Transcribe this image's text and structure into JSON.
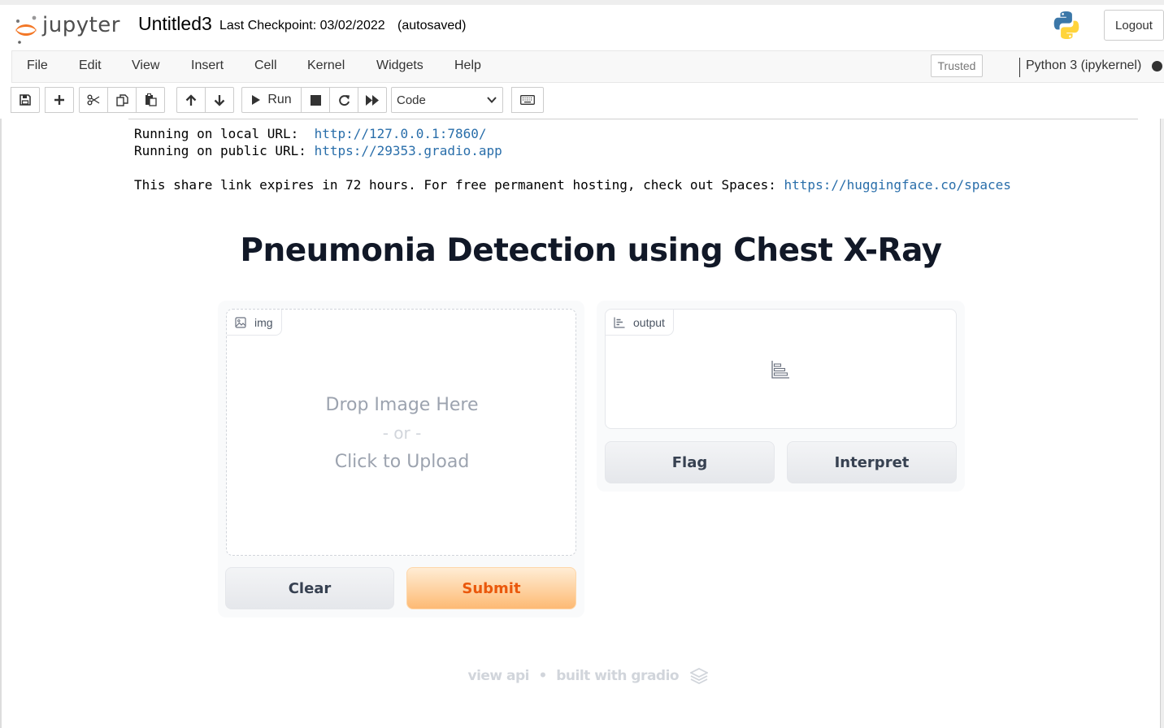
{
  "header": {
    "logo_text": "jupyter",
    "notebook_name": "Untitled3",
    "checkpoint": "Last Checkpoint: 03/02/2022",
    "autosave": "(autosaved)",
    "logout_label": "Logout"
  },
  "menubar": {
    "items": [
      "File",
      "Edit",
      "View",
      "Insert",
      "Cell",
      "Kernel",
      "Widgets",
      "Help"
    ],
    "trusted_label": "Trusted",
    "kernel_name": "Python 3 (ipykernel)"
  },
  "toolbar": {
    "run_label": "Run",
    "cell_type": "Code",
    "cell_type_options": [
      "Code"
    ]
  },
  "output": {
    "local_prefix": "Running on local URL:  ",
    "local_url": "http://127.0.0.1:7860/",
    "public_prefix": "Running on public URL: ",
    "public_url": "https://29353.gradio.app",
    "share_text": "This share link expires in 72 hours. For free permanent hosting, check out Spaces: ",
    "spaces_url": "https://huggingface.co/spaces"
  },
  "gradio": {
    "title": "Pneumonia Detection using Chest X-Ray",
    "input_label": "img",
    "drop_line1": "Drop Image Here",
    "drop_line2": "- or -",
    "drop_line3": "Click to Upload",
    "clear_label": "Clear",
    "submit_label": "Submit",
    "output_label": "output",
    "flag_label": "Flag",
    "interpret_label": "Interpret",
    "footer_api": "view api",
    "footer_dot": "•",
    "footer_built": "built with gradio"
  },
  "colors": {
    "jupyter_orange": "#f37726",
    "link": "#296eaa",
    "primary_button_text": "#ea580c",
    "title_text": "#111827"
  }
}
